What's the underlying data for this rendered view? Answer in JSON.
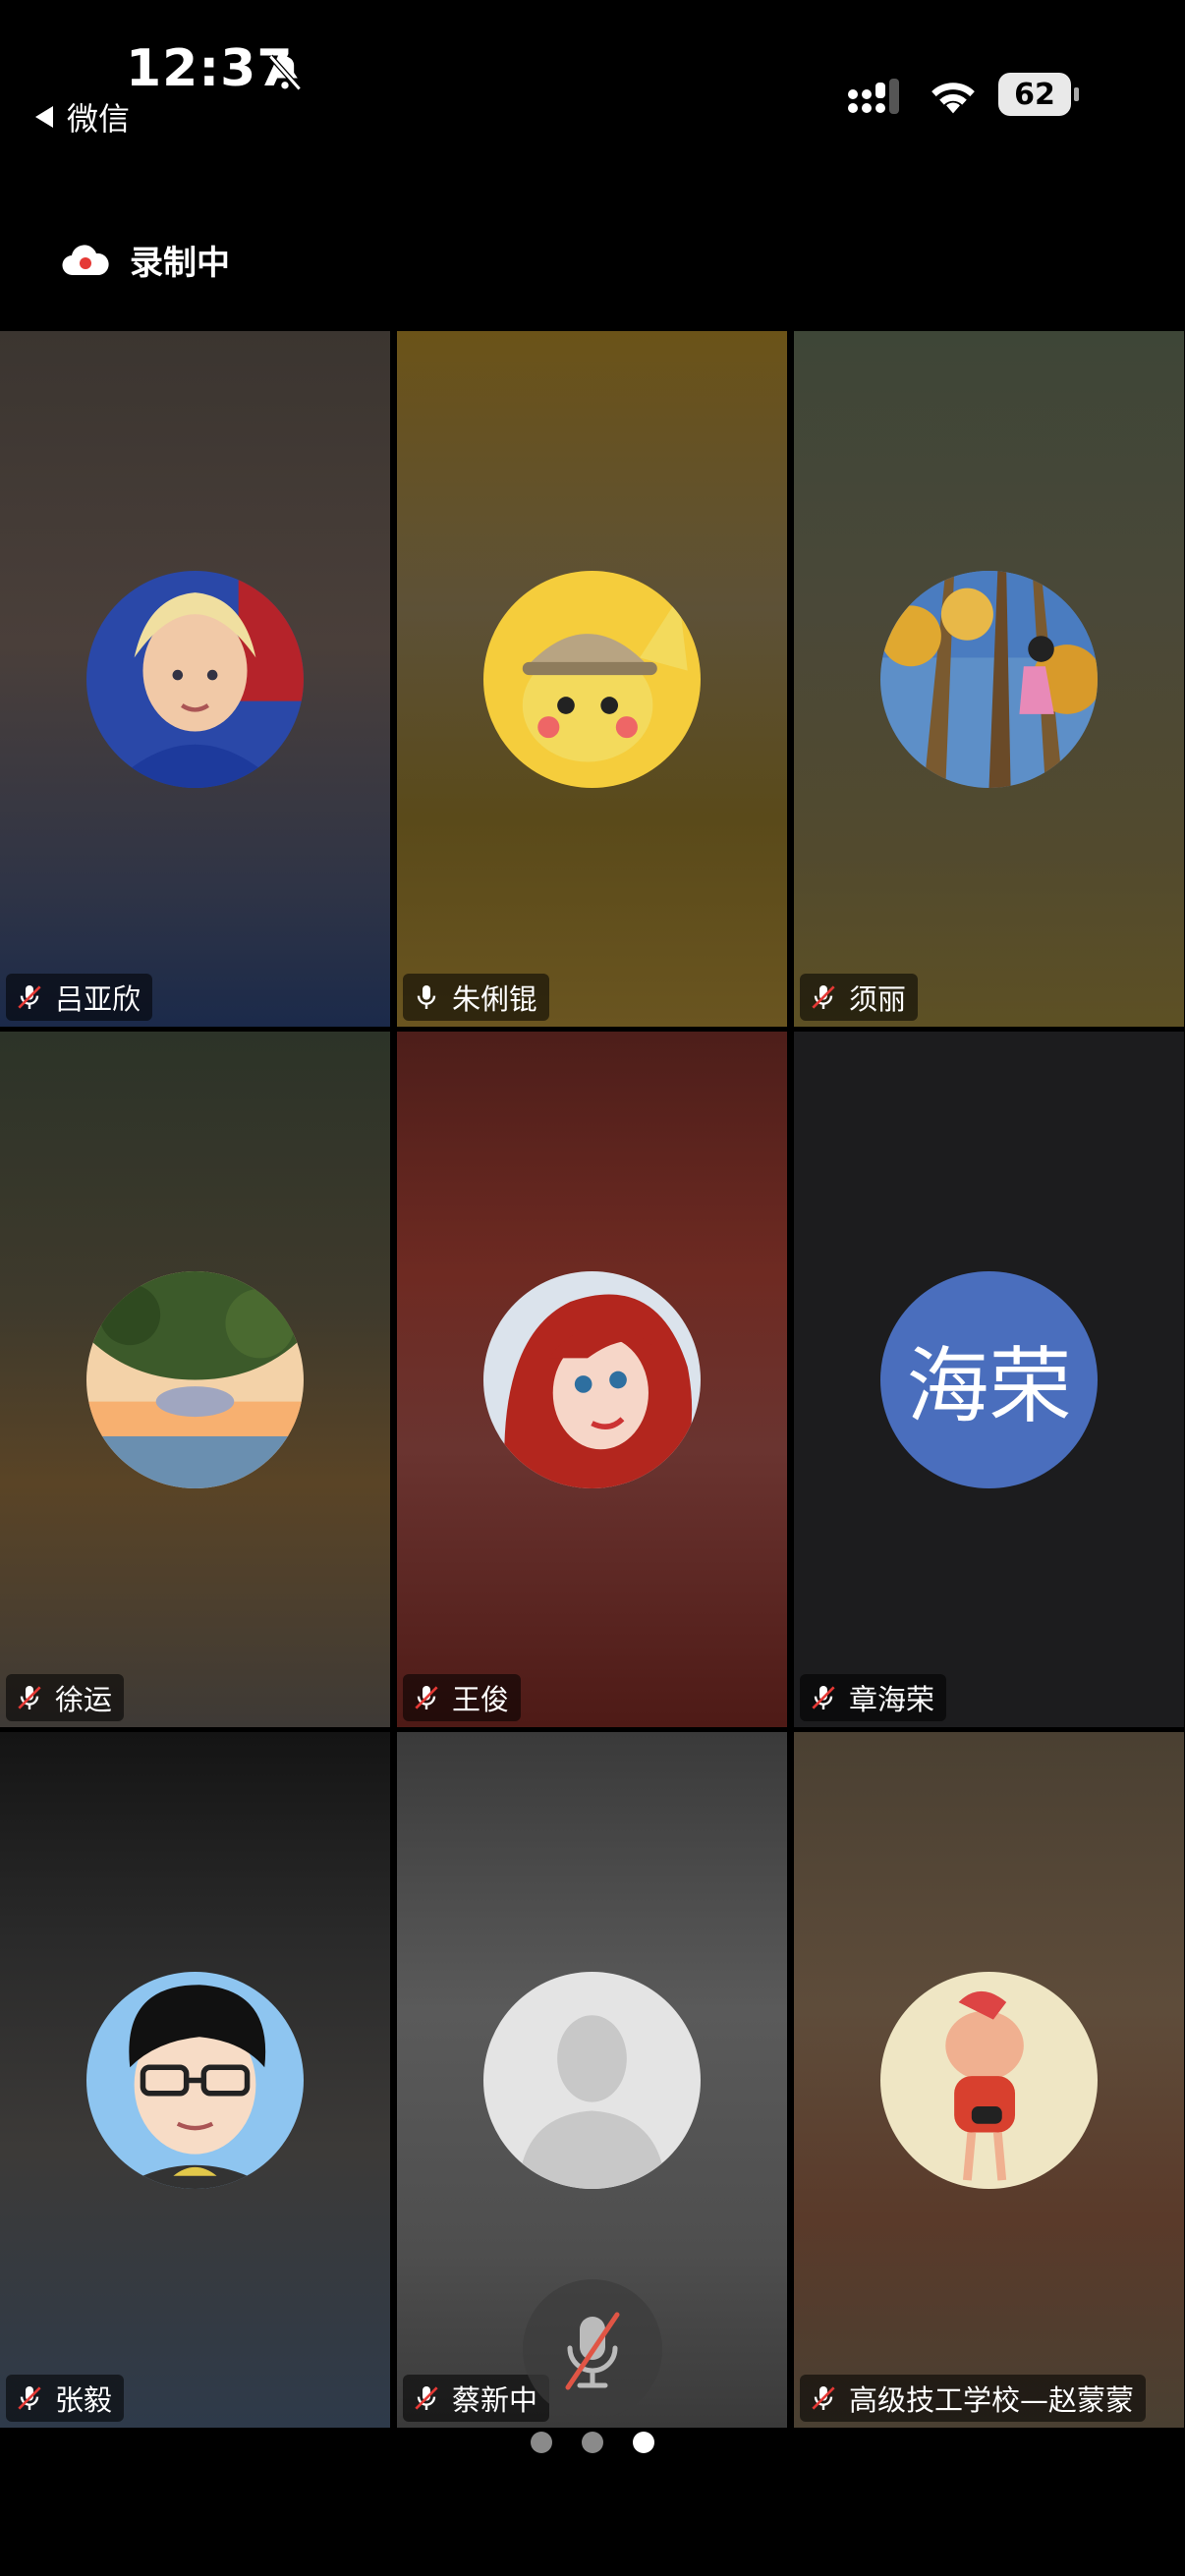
{
  "status_bar": {
    "time": "12:37",
    "back_label": "微信",
    "battery": "62"
  },
  "recording": {
    "label": "录制中",
    "icon": "cloud-record-icon",
    "accent": "#e53935"
  },
  "participants": [
    {
      "name": "吕亚欣",
      "mic": "muted"
    },
    {
      "name": "朱俐锟",
      "mic": "on"
    },
    {
      "name": "须丽",
      "mic": "muted"
    },
    {
      "name": "徐运",
      "mic": "muted"
    },
    {
      "name": "王俊",
      "mic": "muted"
    },
    {
      "name": "章海荣",
      "mic": "muted",
      "avatar_text": "海荣"
    },
    {
      "name": "张毅",
      "mic": "muted"
    },
    {
      "name": "蔡新中",
      "mic": "muted"
    },
    {
      "name": "高级技工学校—赵蒙蒙",
      "mic": "muted"
    }
  ],
  "pagination": {
    "pages": 3,
    "current": 3
  },
  "colors": {
    "text_avatar_bg": "#4a6ebd",
    "background": "#000000"
  }
}
